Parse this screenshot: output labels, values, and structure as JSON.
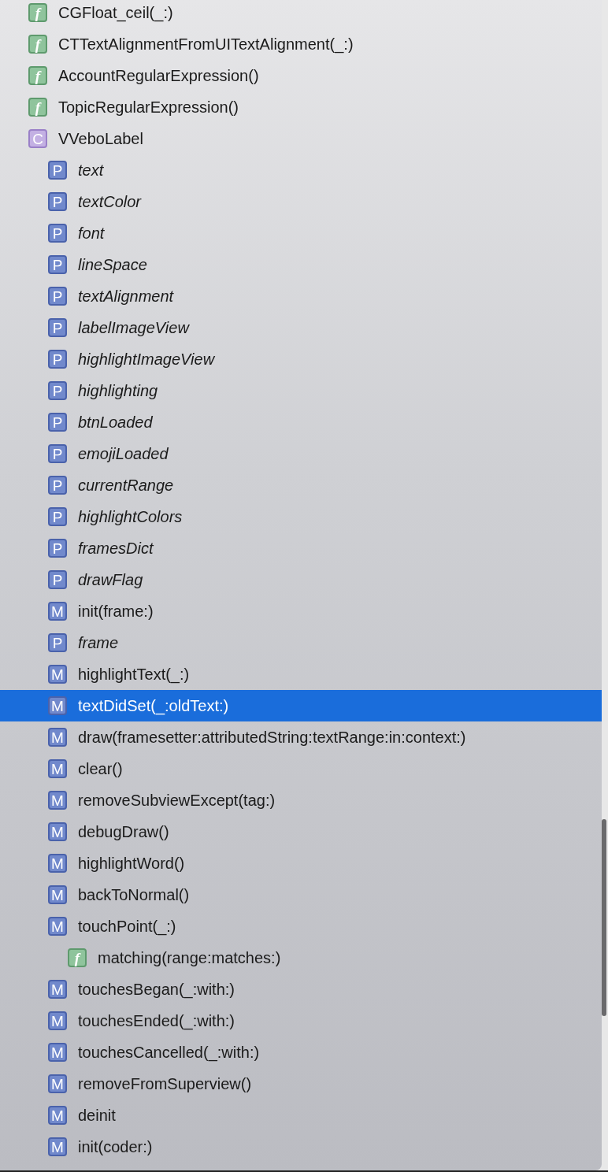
{
  "items": [
    {
      "kind": "function",
      "symbol": "f",
      "label": "CGFloat_ceil(_:)",
      "selected": false
    },
    {
      "kind": "function",
      "symbol": "f",
      "label": "CTTextAlignmentFromUITextAlignment(_:)",
      "selected": false
    },
    {
      "kind": "function",
      "symbol": "f",
      "label": "AccountRegularExpression()",
      "selected": false
    },
    {
      "kind": "function",
      "symbol": "f",
      "label": "TopicRegularExpression()",
      "selected": false
    },
    {
      "kind": "class",
      "symbol": "C",
      "label": "VVeboLabel",
      "selected": false,
      "children": [
        {
          "kind": "property",
          "symbol": "P",
          "label": "text",
          "selected": false
        },
        {
          "kind": "property",
          "symbol": "P",
          "label": "textColor",
          "selected": false
        },
        {
          "kind": "property",
          "symbol": "P",
          "label": "font",
          "selected": false
        },
        {
          "kind": "property",
          "symbol": "P",
          "label": "lineSpace",
          "selected": false
        },
        {
          "kind": "property",
          "symbol": "P",
          "label": "textAlignment",
          "selected": false
        },
        {
          "kind": "property",
          "symbol": "P",
          "label": "labelImageView",
          "selected": false
        },
        {
          "kind": "property",
          "symbol": "P",
          "label": "highlightImageView",
          "selected": false
        },
        {
          "kind": "property",
          "symbol": "P",
          "label": "highlighting",
          "selected": false
        },
        {
          "kind": "property",
          "symbol": "P",
          "label": "btnLoaded",
          "selected": false
        },
        {
          "kind": "property",
          "symbol": "P",
          "label": "emojiLoaded",
          "selected": false
        },
        {
          "kind": "property",
          "symbol": "P",
          "label": "currentRange",
          "selected": false
        },
        {
          "kind": "property",
          "symbol": "P",
          "label": "highlightColors",
          "selected": false
        },
        {
          "kind": "property",
          "symbol": "P",
          "label": "framesDict",
          "selected": false
        },
        {
          "kind": "property",
          "symbol": "P",
          "label": "drawFlag",
          "selected": false
        },
        {
          "kind": "method",
          "symbol": "M",
          "label": "init(frame:)",
          "selected": false
        },
        {
          "kind": "property",
          "symbol": "P",
          "label": "frame",
          "selected": false
        },
        {
          "kind": "method",
          "symbol": "M",
          "label": "highlightText(_:)",
          "selected": false
        },
        {
          "kind": "method",
          "symbol": "M",
          "label": "textDidSet(_:oldText:)",
          "selected": true
        },
        {
          "kind": "method",
          "symbol": "M",
          "label": "draw(framesetter:attributedString:textRange:in:context:)",
          "selected": false
        },
        {
          "kind": "method",
          "symbol": "M",
          "label": "clear()",
          "selected": false
        },
        {
          "kind": "method",
          "symbol": "M",
          "label": "removeSubviewExcept(tag:)",
          "selected": false
        },
        {
          "kind": "method",
          "symbol": "M",
          "label": "debugDraw()",
          "selected": false
        },
        {
          "kind": "method",
          "symbol": "M",
          "label": "highlightWord()",
          "selected": false
        },
        {
          "kind": "method",
          "symbol": "M",
          "label": "backToNormal()",
          "selected": false
        },
        {
          "kind": "method",
          "symbol": "M",
          "label": "touchPoint(_:)",
          "selected": false,
          "children": [
            {
              "kind": "function",
              "symbol": "f",
              "label": "matching(range:matches:)",
              "selected": false
            }
          ]
        },
        {
          "kind": "method",
          "symbol": "M",
          "label": "touchesBegan(_:with:)",
          "selected": false
        },
        {
          "kind": "method",
          "symbol": "M",
          "label": "touchesEnded(_:with:)",
          "selected": false
        },
        {
          "kind": "method",
          "symbol": "M",
          "label": "touchesCancelled(_:with:)",
          "selected": false
        },
        {
          "kind": "method",
          "symbol": "M",
          "label": "removeFromSuperview()",
          "selected": false
        },
        {
          "kind": "method",
          "symbol": "M",
          "label": "deinit",
          "selected": false
        },
        {
          "kind": "method",
          "symbol": "M",
          "label": "init(coder:)",
          "selected": false
        }
      ]
    }
  ]
}
